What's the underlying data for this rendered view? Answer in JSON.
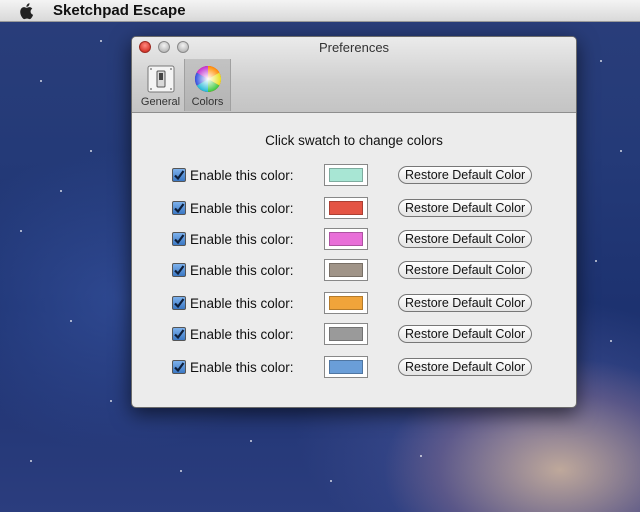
{
  "menubar": {
    "app_name": "Sketchpad Escape"
  },
  "window": {
    "title": "Preferences",
    "toolbar": [
      {
        "label": "General",
        "icon": "switch-icon",
        "selected": false
      },
      {
        "label": "Colors",
        "icon": "color-wheel-icon",
        "selected": true
      }
    ],
    "heading": "Click swatch to change colors",
    "rows": [
      {
        "enabled": true,
        "label": "Enable this color:",
        "color": "#a8e6d4",
        "button": "Restore Default Color"
      },
      {
        "enabled": true,
        "label": "Enable this color:",
        "color": "#e45444",
        "button": "Restore Default Color"
      },
      {
        "enabled": true,
        "label": "Enable this color:",
        "color": "#e86fd8",
        "button": "Restore Default Color"
      },
      {
        "enabled": true,
        "label": "Enable this color:",
        "color": "#a09488",
        "button": "Restore Default Color"
      },
      {
        "enabled": true,
        "label": "Enable this color:",
        "color": "#f0a43a",
        "button": "Restore Default Color"
      },
      {
        "enabled": true,
        "label": "Enable this color:",
        "color": "#9a9a9a",
        "button": "Restore Default Color"
      },
      {
        "enabled": true,
        "label": "Enable this color:",
        "color": "#6a9ed8",
        "button": "Restore Default Color"
      }
    ]
  }
}
